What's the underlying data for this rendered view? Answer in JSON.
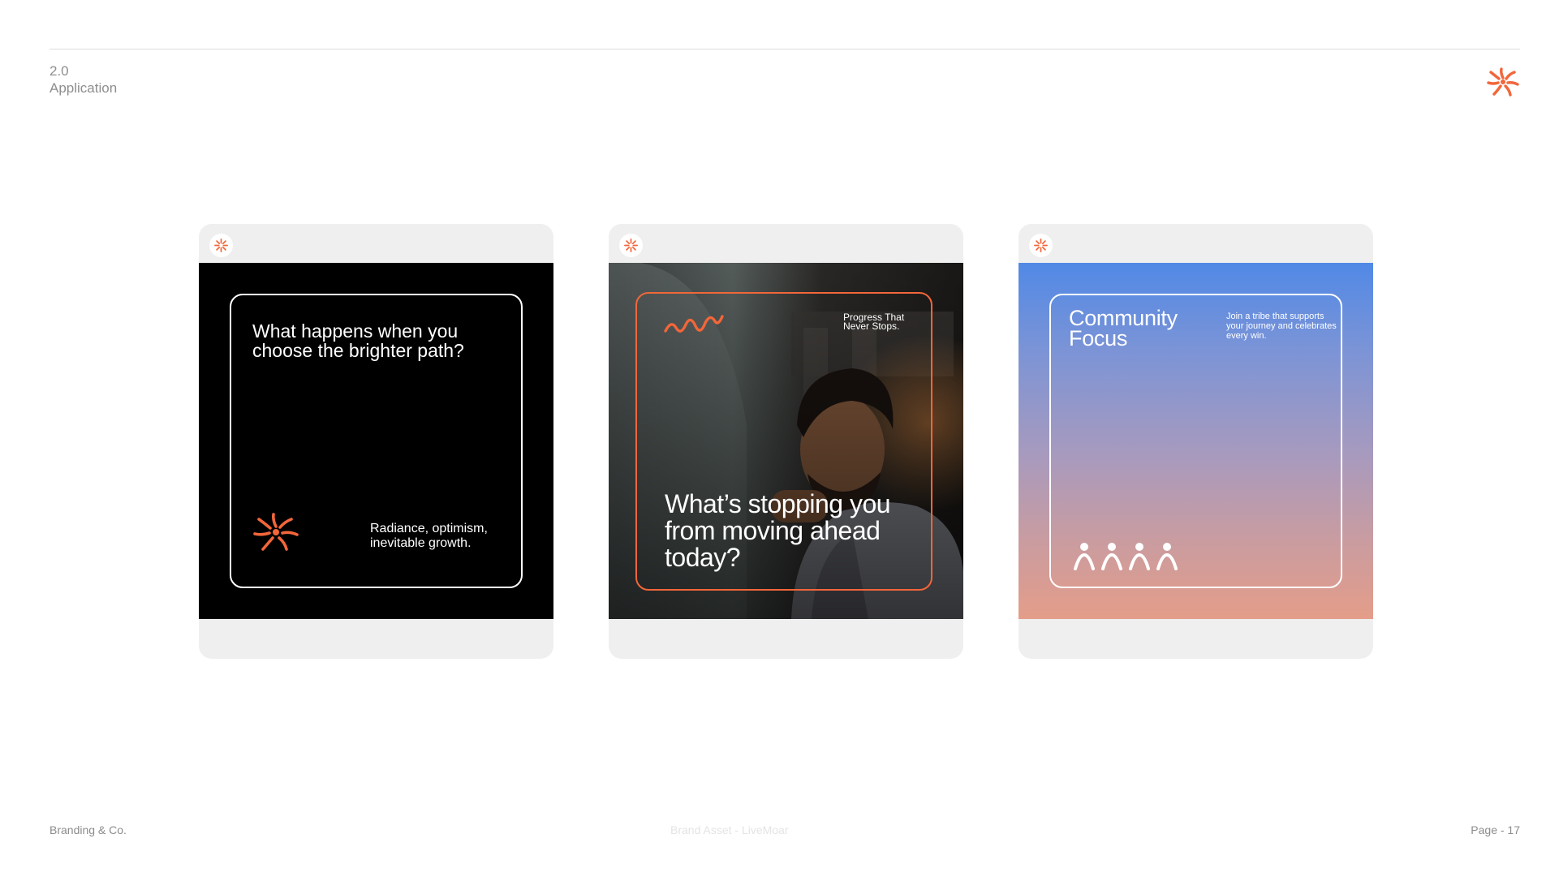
{
  "header": {
    "section_number": "2.0",
    "section_title": "Application",
    "logo_icon": "radiance-burst-icon",
    "accent_color": "#f2663a"
  },
  "cards": [
    {
      "headline": "What happens when you choose the brighter path?",
      "tagline": "Radiance, optimism, inevitable growth.",
      "background": "#000000"
    },
    {
      "kicker": "Progress That Never Stops.",
      "headline": "What’s stopping you from moving ahead today?",
      "image": "smiling-man-at-computer-photo"
    },
    {
      "title": "Community Focus",
      "description": "Join a tribe that supports your journey and celebrates every win.",
      "icon": "community-people-icon"
    }
  ],
  "footer": {
    "left": "Branding & Co.",
    "center": "Brand Asset - LiveMoar",
    "right": "Page - 17"
  }
}
